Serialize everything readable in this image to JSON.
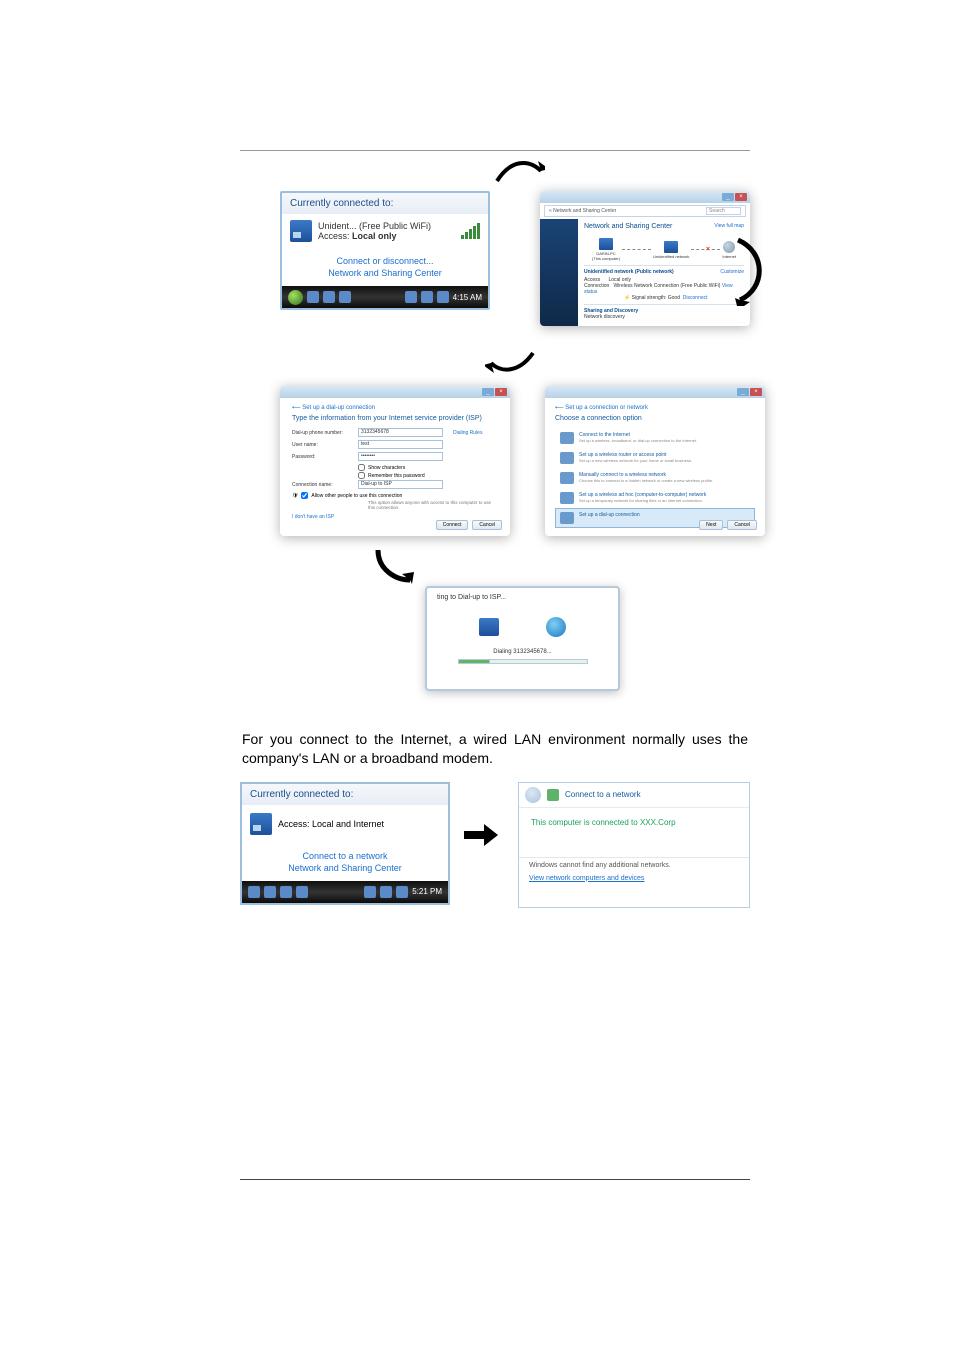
{
  "popup1": {
    "heading": "Currently connected to:",
    "network_name": "Unident... (Free Public WiFi)",
    "access_label": "Access:",
    "access_value": "Local only",
    "link1": "Connect or disconnect...",
    "link2": "Network and Sharing Center",
    "taskbar_time": "4:15 AM"
  },
  "popup2": {
    "breadcrumb": "« Network and Sharing Center",
    "search_placeholder": "Search",
    "title": "Network and Sharing Center",
    "view_full_map": "View full map",
    "node_pc": "DARIN-PC",
    "node_pc_sub": "(This computer)",
    "node_net": "Unidentified network",
    "node_internet": "Internet",
    "section1_title": "Unidentified network (Public network)",
    "section1_custom": "Customize",
    "row_access_label": "Access",
    "row_access_value": "Local only",
    "row_conn_label": "Connection",
    "row_conn_value": "Wireless Network Connection (Free Public WiFi)",
    "row_conn_link": "View status",
    "row_signal_label": "Signal strength:",
    "row_signal_value": "Good",
    "row_signal_link": "Disconnect",
    "section2_title": "Sharing and Discovery",
    "section2_row": "Network discovery"
  },
  "popup3": {
    "back": "Set up a dial-up connection",
    "heading": "Type the information from your Internet service provider (ISP)",
    "f_phone_label": "Dial-up phone number:",
    "f_phone_value": "3132345678",
    "f_phone_rules": "Dialing Rules",
    "f_user_label": "User name:",
    "f_user_value": "test",
    "f_pass_label": "Password:",
    "f_pass_value": "••••••••",
    "cb_show": "Show characters",
    "cb_remember": "Remember this password",
    "f_conn_label": "Connection name:",
    "f_conn_value": "Dial-up to ISP",
    "cb_allow": "Allow other people to use this connection",
    "cb_allow_note": "This option allows anyone with access to this computer to use this connection.",
    "link_noisp": "I don't have an ISP",
    "btn_connect": "Connect",
    "btn_cancel": "Cancel"
  },
  "popup4": {
    "back": "Set up a connection or network",
    "heading": "Choose a connection option",
    "opt1_t": "Connect to the Internet",
    "opt1_d": "Set up a wireless, broadband, or dial-up connection to the Internet.",
    "opt2_t": "Set up a wireless router or access point",
    "opt2_d": "Set up a new wireless network for your home or small business.",
    "opt3_t": "Manually connect to a wireless network",
    "opt3_d": "Choose this to connect to a hidden network or create a new wireless profile.",
    "opt4_t": "Set up a wireless ad hoc (computer-to-computer) network",
    "opt4_d": "Set up a temporary network for sharing files or an Internet connection.",
    "opt5_t": "Set up a dial-up connection",
    "btn_next": "Next",
    "btn_cancel": "Cancel"
  },
  "popup5": {
    "title": "ting to Dial-up to ISP...",
    "status": "Dialing 3132345678..."
  },
  "body_text": "For you connect to the Internet, a wired LAN environment normally uses the company's LAN or a broadband modem.",
  "popup6": {
    "heading": "Currently connected to:",
    "access_line": "Access:  Local and Internet",
    "link1": "Connect to a network",
    "link2": "Network and Sharing Center",
    "taskbar_time": "5:21 PM"
  },
  "popup7": {
    "title": "Connect to a network",
    "msg": "This computer is connected to XXX.Corp",
    "note": "Windows cannot find any additional networks.",
    "link": "View network computers and devices"
  }
}
